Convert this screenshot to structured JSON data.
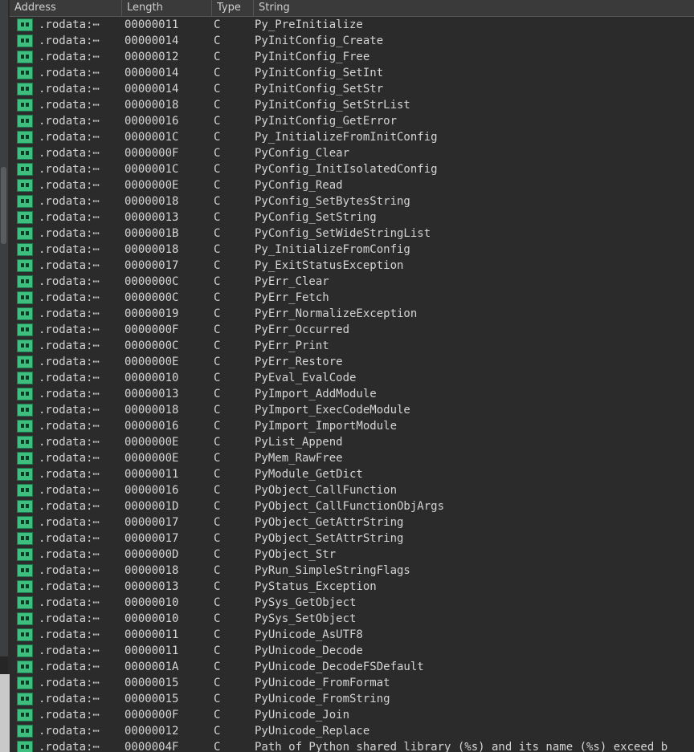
{
  "header": {
    "columns": [
      "Address",
      "Length",
      "Type",
      "String"
    ]
  },
  "rows": [
    {
      "addr": ".rodata:⋯",
      "len": "00000011",
      "type": "C",
      "str": "Py_PreInitialize"
    },
    {
      "addr": ".rodata:⋯",
      "len": "00000014",
      "type": "C",
      "str": "PyInitConfig_Create"
    },
    {
      "addr": ".rodata:⋯",
      "len": "00000012",
      "type": "C",
      "str": "PyInitConfig_Free"
    },
    {
      "addr": ".rodata:⋯",
      "len": "00000014",
      "type": "C",
      "str": "PyInitConfig_SetInt"
    },
    {
      "addr": ".rodata:⋯",
      "len": "00000014",
      "type": "C",
      "str": "PyInitConfig_SetStr"
    },
    {
      "addr": ".rodata:⋯",
      "len": "00000018",
      "type": "C",
      "str": "PyInitConfig_SetStrList"
    },
    {
      "addr": ".rodata:⋯",
      "len": "00000016",
      "type": "C",
      "str": "PyInitConfig_GetError"
    },
    {
      "addr": ".rodata:⋯",
      "len": "0000001C",
      "type": "C",
      "str": "Py_InitializeFromInitConfig"
    },
    {
      "addr": ".rodata:⋯",
      "len": "0000000F",
      "type": "C",
      "str": "PyConfig_Clear"
    },
    {
      "addr": ".rodata:⋯",
      "len": "0000001C",
      "type": "C",
      "str": "PyConfig_InitIsolatedConfig"
    },
    {
      "addr": ".rodata:⋯",
      "len": "0000000E",
      "type": "C",
      "str": "PyConfig_Read"
    },
    {
      "addr": ".rodata:⋯",
      "len": "00000018",
      "type": "C",
      "str": "PyConfig_SetBytesString"
    },
    {
      "addr": ".rodata:⋯",
      "len": "00000013",
      "type": "C",
      "str": "PyConfig_SetString"
    },
    {
      "addr": ".rodata:⋯",
      "len": "0000001B",
      "type": "C",
      "str": "PyConfig_SetWideStringList"
    },
    {
      "addr": ".rodata:⋯",
      "len": "00000018",
      "type": "C",
      "str": "Py_InitializeFromConfig"
    },
    {
      "addr": ".rodata:⋯",
      "len": "00000017",
      "type": "C",
      "str": "Py_ExitStatusException"
    },
    {
      "addr": ".rodata:⋯",
      "len": "0000000C",
      "type": "C",
      "str": "PyErr_Clear"
    },
    {
      "addr": ".rodata:⋯",
      "len": "0000000C",
      "type": "C",
      "str": "PyErr_Fetch"
    },
    {
      "addr": ".rodata:⋯",
      "len": "00000019",
      "type": "C",
      "str": "PyErr_NormalizeException"
    },
    {
      "addr": ".rodata:⋯",
      "len": "0000000F",
      "type": "C",
      "str": "PyErr_Occurred"
    },
    {
      "addr": ".rodata:⋯",
      "len": "0000000C",
      "type": "C",
      "str": "PyErr_Print"
    },
    {
      "addr": ".rodata:⋯",
      "len": "0000000E",
      "type": "C",
      "str": "PyErr_Restore"
    },
    {
      "addr": ".rodata:⋯",
      "len": "00000010",
      "type": "C",
      "str": "PyEval_EvalCode"
    },
    {
      "addr": ".rodata:⋯",
      "len": "00000013",
      "type": "C",
      "str": "PyImport_AddModule"
    },
    {
      "addr": ".rodata:⋯",
      "len": "00000018",
      "type": "C",
      "str": "PyImport_ExecCodeModule"
    },
    {
      "addr": ".rodata:⋯",
      "len": "00000016",
      "type": "C",
      "str": "PyImport_ImportModule"
    },
    {
      "addr": ".rodata:⋯",
      "len": "0000000E",
      "type": "C",
      "str": "PyList_Append"
    },
    {
      "addr": ".rodata:⋯",
      "len": "0000000E",
      "type": "C",
      "str": "PyMem_RawFree"
    },
    {
      "addr": ".rodata:⋯",
      "len": "00000011",
      "type": "C",
      "str": "PyModule_GetDict"
    },
    {
      "addr": ".rodata:⋯",
      "len": "00000016",
      "type": "C",
      "str": "PyObject_CallFunction"
    },
    {
      "addr": ".rodata:⋯",
      "len": "0000001D",
      "type": "C",
      "str": "PyObject_CallFunctionObjArgs"
    },
    {
      "addr": ".rodata:⋯",
      "len": "00000017",
      "type": "C",
      "str": "PyObject_GetAttrString"
    },
    {
      "addr": ".rodata:⋯",
      "len": "00000017",
      "type": "C",
      "str": "PyObject_SetAttrString"
    },
    {
      "addr": ".rodata:⋯",
      "len": "0000000D",
      "type": "C",
      "str": "PyObject_Str"
    },
    {
      "addr": ".rodata:⋯",
      "len": "00000018",
      "type": "C",
      "str": "PyRun_SimpleStringFlags"
    },
    {
      "addr": ".rodata:⋯",
      "len": "00000013",
      "type": "C",
      "str": "PyStatus_Exception"
    },
    {
      "addr": ".rodata:⋯",
      "len": "00000010",
      "type": "C",
      "str": "PySys_GetObject"
    },
    {
      "addr": ".rodata:⋯",
      "len": "00000010",
      "type": "C",
      "str": "PySys_SetObject"
    },
    {
      "addr": ".rodata:⋯",
      "len": "00000011",
      "type": "C",
      "str": "PyUnicode_AsUTF8"
    },
    {
      "addr": ".rodata:⋯",
      "len": "00000011",
      "type": "C",
      "str": "PyUnicode_Decode"
    },
    {
      "addr": ".rodata:⋯",
      "len": "0000001A",
      "type": "C",
      "str": "PyUnicode_DecodeFSDefault"
    },
    {
      "addr": ".rodata:⋯",
      "len": "00000015",
      "type": "C",
      "str": "PyUnicode_FromFormat"
    },
    {
      "addr": ".rodata:⋯",
      "len": "00000015",
      "type": "C",
      "str": "PyUnicode_FromString"
    },
    {
      "addr": ".rodata:⋯",
      "len": "0000000F",
      "type": "C",
      "str": "PyUnicode_Join"
    },
    {
      "addr": ".rodata:⋯",
      "len": "00000012",
      "type": "C",
      "str": "PyUnicode_Replace"
    },
    {
      "addr": ".rodata:⋯",
      "len": "0000004F",
      "type": "C",
      "str": "Path of Python shared library (%s) and its name (%s) exceed b"
    }
  ],
  "colors": {
    "background": "#2b2b2b",
    "text": "#d4d4d4",
    "string_icon": "#3fbf7f"
  },
  "icons": {
    "row": "string-literal-icon"
  }
}
